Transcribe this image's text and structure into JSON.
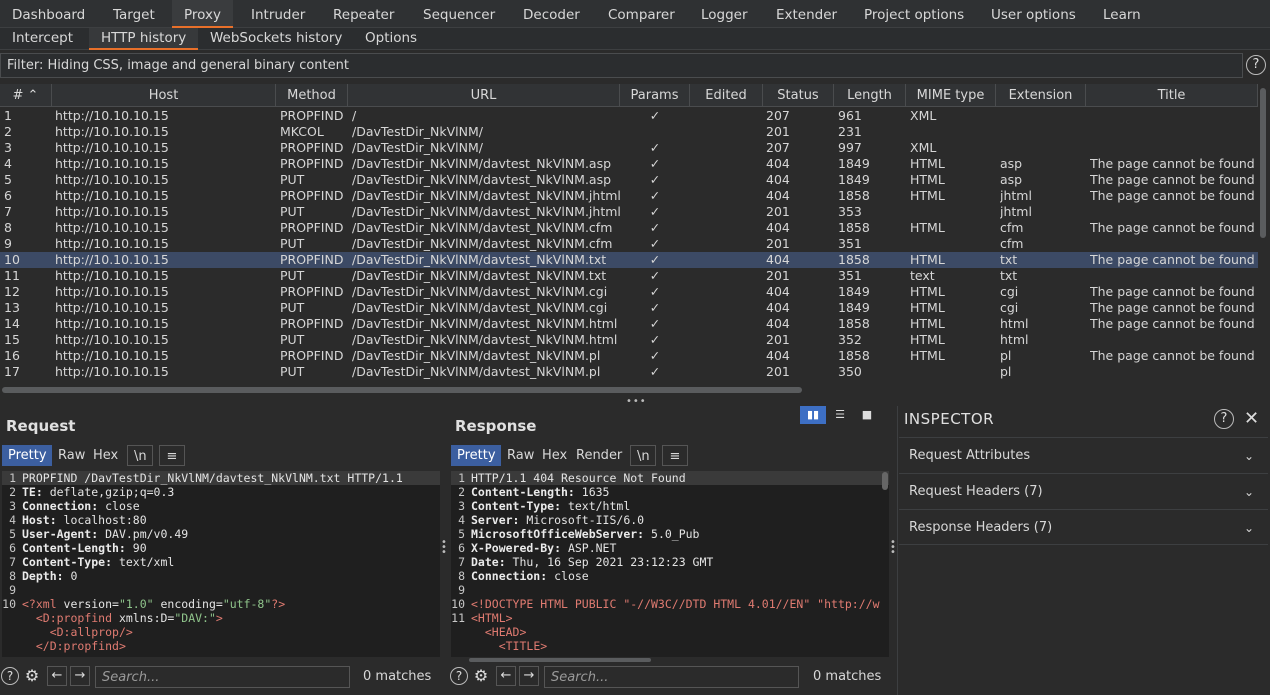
{
  "main_tabs": [
    {
      "label": "Dashboard",
      "active": false
    },
    {
      "label": "Target",
      "active": false
    },
    {
      "label": "Proxy",
      "active": true
    },
    {
      "label": "Intruder",
      "active": false
    },
    {
      "label": "Repeater",
      "active": false
    },
    {
      "label": "Sequencer",
      "active": false
    },
    {
      "label": "Decoder",
      "active": false
    },
    {
      "label": "Comparer",
      "active": false
    },
    {
      "label": "Logger",
      "active": false
    },
    {
      "label": "Extender",
      "active": false
    },
    {
      "label": "Project options",
      "active": false
    },
    {
      "label": "User options",
      "active": false
    },
    {
      "label": "Learn",
      "active": false
    }
  ],
  "sub_tabs": [
    {
      "label": "Intercept",
      "active": false
    },
    {
      "label": "HTTP history",
      "active": true
    },
    {
      "label": "WebSockets history",
      "active": false
    },
    {
      "label": "Options",
      "active": false
    }
  ],
  "filter": {
    "text": "Filter: Hiding CSS, image and general binary content",
    "help_label": "?"
  },
  "table": {
    "columns": [
      "# ⌃",
      "Host",
      "Method",
      "URL",
      "Params",
      "Edited",
      "Status",
      "Length",
      "MIME type",
      "Extension",
      "Title"
    ],
    "selected_row": 10,
    "rows": [
      [
        "1",
        "http://10.10.10.15",
        "PROPFIND",
        "/",
        "✓",
        "",
        "207",
        "961",
        "XML",
        "",
        ""
      ],
      [
        "2",
        "http://10.10.10.15",
        "MKCOL",
        "/DavTestDir_NkVlNM/",
        "",
        "",
        "201",
        "231",
        "",
        "",
        ""
      ],
      [
        "3",
        "http://10.10.10.15",
        "PROPFIND",
        "/DavTestDir_NkVlNM/",
        "✓",
        "",
        "207",
        "997",
        "XML",
        "",
        ""
      ],
      [
        "4",
        "http://10.10.10.15",
        "PROPFIND",
        "/DavTestDir_NkVlNM/davtest_NkVlNM.asp",
        "✓",
        "",
        "404",
        "1849",
        "HTML",
        "asp",
        "The page cannot be found"
      ],
      [
        "5",
        "http://10.10.10.15",
        "PUT",
        "/DavTestDir_NkVlNM/davtest_NkVlNM.asp",
        "✓",
        "",
        "404",
        "1849",
        "HTML",
        "asp",
        "The page cannot be found"
      ],
      [
        "6",
        "http://10.10.10.15",
        "PROPFIND",
        "/DavTestDir_NkVlNM/davtest_NkVlNM.jhtml",
        "✓",
        "",
        "404",
        "1858",
        "HTML",
        "jhtml",
        "The page cannot be found"
      ],
      [
        "7",
        "http://10.10.10.15",
        "PUT",
        "/DavTestDir_NkVlNM/davtest_NkVlNM.jhtml",
        "✓",
        "",
        "201",
        "353",
        "",
        "jhtml",
        ""
      ],
      [
        "8",
        "http://10.10.10.15",
        "PROPFIND",
        "/DavTestDir_NkVlNM/davtest_NkVlNM.cfm",
        "✓",
        "",
        "404",
        "1858",
        "HTML",
        "cfm",
        "The page cannot be found"
      ],
      [
        "9",
        "http://10.10.10.15",
        "PUT",
        "/DavTestDir_NkVlNM/davtest_NkVlNM.cfm",
        "✓",
        "",
        "201",
        "351",
        "",
        "cfm",
        ""
      ],
      [
        "10",
        "http://10.10.10.15",
        "PROPFIND",
        "/DavTestDir_NkVlNM/davtest_NkVlNM.txt",
        "✓",
        "",
        "404",
        "1858",
        "HTML",
        "txt",
        "The page cannot be found"
      ],
      [
        "11",
        "http://10.10.10.15",
        "PUT",
        "/DavTestDir_NkVlNM/davtest_NkVlNM.txt",
        "✓",
        "",
        "201",
        "351",
        "text",
        "txt",
        ""
      ],
      [
        "12",
        "http://10.10.10.15",
        "PROPFIND",
        "/DavTestDir_NkVlNM/davtest_NkVlNM.cgi",
        "✓",
        "",
        "404",
        "1849",
        "HTML",
        "cgi",
        "The page cannot be found"
      ],
      [
        "13",
        "http://10.10.10.15",
        "PUT",
        "/DavTestDir_NkVlNM/davtest_NkVlNM.cgi",
        "✓",
        "",
        "404",
        "1849",
        "HTML",
        "cgi",
        "The page cannot be found"
      ],
      [
        "14",
        "http://10.10.10.15",
        "PROPFIND",
        "/DavTestDir_NkVlNM/davtest_NkVlNM.html",
        "✓",
        "",
        "404",
        "1858",
        "HTML",
        "html",
        "The page cannot be found"
      ],
      [
        "15",
        "http://10.10.10.15",
        "PUT",
        "/DavTestDir_NkVlNM/davtest_NkVlNM.html",
        "✓",
        "",
        "201",
        "352",
        "HTML",
        "html",
        ""
      ],
      [
        "16",
        "http://10.10.10.15",
        "PROPFIND",
        "/DavTestDir_NkVlNM/davtest_NkVlNM.pl",
        "✓",
        "",
        "404",
        "1858",
        "HTML",
        "pl",
        "The page cannot be found"
      ],
      [
        "17",
        "http://10.10.10.15",
        "PUT",
        "/DavTestDir_NkVlNM/davtest_NkVlNM.pl",
        "✓",
        "",
        "201",
        "350",
        "",
        "pl",
        ""
      ]
    ]
  },
  "request": {
    "title": "Request",
    "tabs": [
      "Pretty",
      "Raw",
      "Hex",
      "\\n",
      "≡"
    ],
    "active_tab": "Pretty",
    "lines": [
      {
        "n": "1",
        "key": "",
        "text": "PROPFIND /DavTestDir_NkVlNM/davtest_NkVlNM.txt HTTP/1.1",
        "highlight": true
      },
      {
        "n": "2",
        "key": "TE:",
        "text": " deflate,gzip;q=0.3"
      },
      {
        "n": "3",
        "key": "Connection:",
        "text": " close"
      },
      {
        "n": "4",
        "key": "Host:",
        "text": " localhost:80"
      },
      {
        "n": "5",
        "key": "User-Agent:",
        "text": " DAV.pm/v0.49"
      },
      {
        "n": "6",
        "key": "Content-Length:",
        "text": " 90"
      },
      {
        "n": "7",
        "key": "Content-Type:",
        "text": " text/xml"
      },
      {
        "n": "8",
        "key": "Depth:",
        "text": " 0"
      },
      {
        "n": "9",
        "key": "",
        "text": ""
      }
    ],
    "xml_lines": [
      {
        "n": "10",
        "parts": [
          [
            "tag",
            "<?xml"
          ],
          [
            "attr",
            " version="
          ],
          [
            "str",
            "\"1.0\""
          ],
          [
            "attr",
            " encoding="
          ],
          [
            "str",
            "\"utf-8\""
          ],
          [
            "tag",
            "?>"
          ]
        ]
      },
      {
        "n": "",
        "parts": [
          [
            "attr",
            "  "
          ],
          [
            "tag",
            "<D:propfind"
          ],
          [
            "attr",
            " xmlns:D="
          ],
          [
            "str",
            "\"DAV:\""
          ],
          [
            "tag",
            ">"
          ]
        ]
      },
      {
        "n": "",
        "parts": [
          [
            "attr",
            "    "
          ],
          [
            "tag",
            "<D:allprop/>"
          ]
        ]
      },
      {
        "n": "",
        "parts": [
          [
            "attr",
            "  "
          ],
          [
            "tag",
            "</D:propfind>"
          ]
        ]
      }
    ],
    "search_placeholder": "Search...",
    "matches": "0 matches"
  },
  "response": {
    "title": "Response",
    "tabs": [
      "Pretty",
      "Raw",
      "Hex",
      "Render",
      "\\n",
      "≡"
    ],
    "active_tab": "Pretty",
    "lines": [
      {
        "n": "1",
        "key": "",
        "text": "HTTP/1.1 404 Resource Not Found",
        "highlight": true
      },
      {
        "n": "2",
        "key": "Content-Length:",
        "text": " 1635"
      },
      {
        "n": "3",
        "key": "Content-Type:",
        "text": " text/html"
      },
      {
        "n": "4",
        "key": "Server:",
        "text": " Microsoft-IIS/6.0"
      },
      {
        "n": "5",
        "key": "MicrosoftOfficeWebServer:",
        "text": " 5.0_Pub"
      },
      {
        "n": "6",
        "key": "X-Powered-By:",
        "text": " ASP.NET"
      },
      {
        "n": "7",
        "key": "Date:",
        "text": " Thu, 16 Sep 2021 23:12:23 GMT"
      },
      {
        "n": "8",
        "key": "Connection:",
        "text": " close"
      },
      {
        "n": "9",
        "key": "",
        "text": ""
      }
    ],
    "html_lines": [
      {
        "n": "10",
        "parts": [
          [
            "tag",
            "<!DOCTYPE HTML PUBLIC \"-//W3C//DTD HTML 4.01//EN\" \"http://w"
          ]
        ]
      },
      {
        "n": "11",
        "parts": [
          [
            "tag",
            "<HTML>"
          ]
        ]
      },
      {
        "n": "",
        "parts": [
          [
            "attr",
            "  "
          ],
          [
            "tag",
            "<HEAD>"
          ]
        ]
      },
      {
        "n": "",
        "parts": [
          [
            "attr",
            "    "
          ],
          [
            "tag",
            "<TITLE>"
          ]
        ]
      }
    ],
    "search_placeholder": "Search...",
    "matches": "0 matches"
  },
  "inspector": {
    "title": "INSPECTOR",
    "help_label": "?",
    "close_label": "✕",
    "sections": [
      {
        "label": "Request Attributes"
      },
      {
        "label": "Request Headers (7)"
      },
      {
        "label": "Response Headers (7)"
      }
    ]
  },
  "colors": {
    "accent": "#e8702a",
    "selected_row": "#3c4a65",
    "active_view_tab": "#3c5fa0",
    "layout_active": "#3d6fc4"
  }
}
